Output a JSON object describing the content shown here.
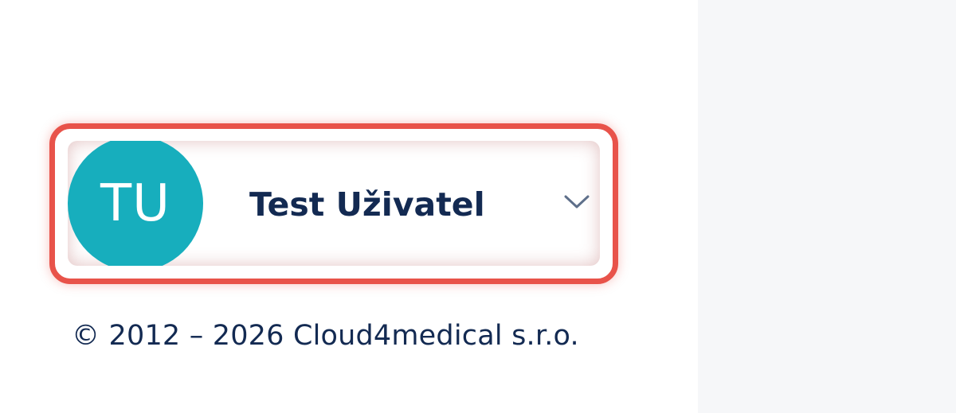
{
  "user_menu": {
    "initials": "TU",
    "name": "Test Uživatel",
    "dropdown_icon": "chevron-down-icon"
  },
  "footer": {
    "copyright": "© 2012 – 2026 Cloud4medical s.r.o."
  },
  "colors": {
    "avatar_bg": "#17aebd",
    "text": "#132a52",
    "highlight": "#e8534a",
    "side_panel": "#f6f7f9"
  }
}
